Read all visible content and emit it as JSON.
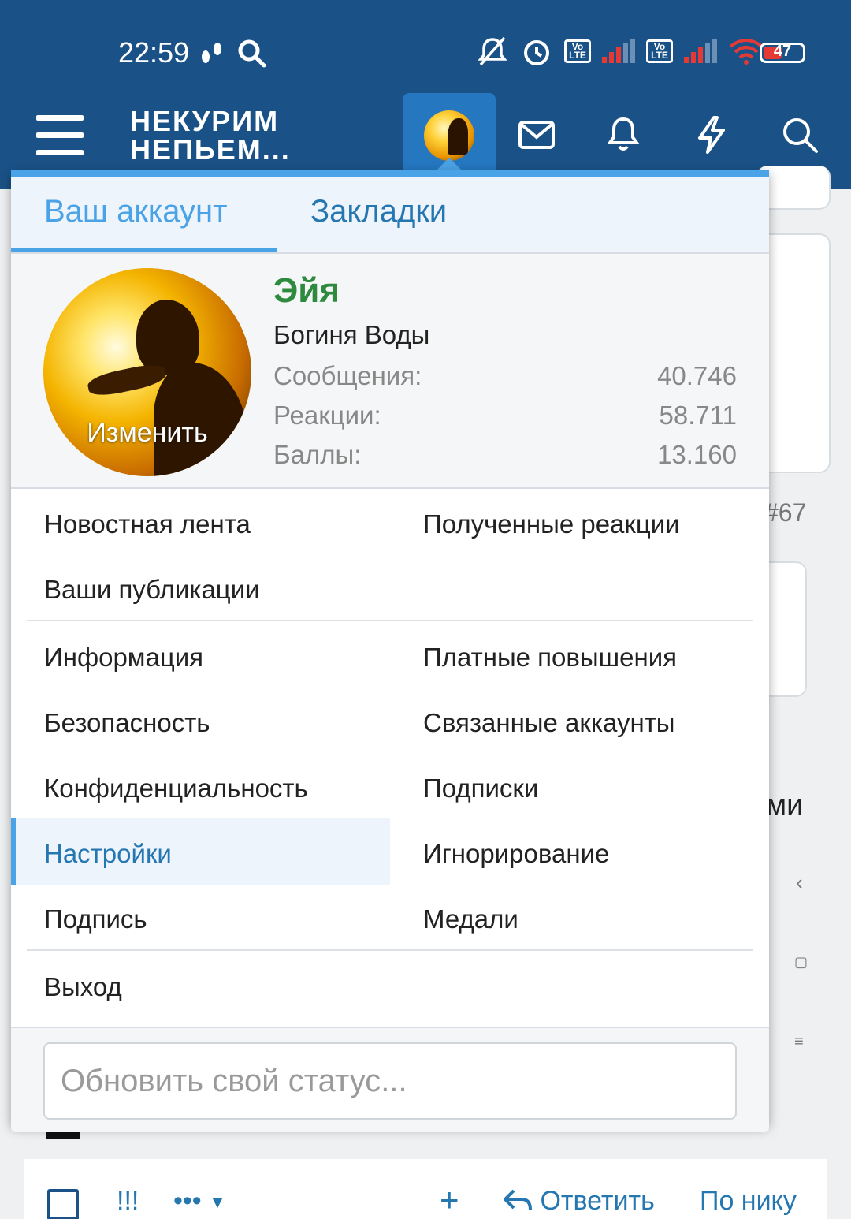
{
  "status_bar": {
    "time": "22:59",
    "battery": "47",
    "battery_level": 0.47,
    "volte": "Vo LTE"
  },
  "header": {
    "logo_line1": "НЕКУРИМ",
    "logo_line2": "НЕПЬЕМ...",
    "icons": [
      "menu-icon",
      "avatar",
      "mail-icon",
      "bell-icon",
      "bolt-icon",
      "search-icon"
    ]
  },
  "background": {
    "post_number": "#67",
    "partial_text": "ми"
  },
  "menu": {
    "tabs": [
      {
        "label": "Ваш аккаунт",
        "active": true
      },
      {
        "label": "Закладки",
        "active": false
      }
    ],
    "profile": {
      "avatar_edit": "Изменить",
      "name": "Эйя",
      "title": "Богиня Воды",
      "stats": [
        {
          "label": "Сообщения:",
          "value": "40.746"
        },
        {
          "label": "Реакции:",
          "value": "58.711"
        },
        {
          "label": "Баллы:",
          "value": "13.160"
        }
      ]
    },
    "items": {
      "news_feed": "Новостная лента",
      "received_reactions": "Полученные реакции",
      "your_posts": "Ваши публикации",
      "info": "Информация",
      "paid_upgrades": "Платные повышения",
      "security": "Безопасность",
      "connected_accounts": "Связанные аккаунты",
      "privacy": "Конфиденциальность",
      "subscriptions": "Подписки",
      "settings": "Настройки",
      "ignoring": "Игнорирование",
      "signature": "Подпись",
      "medals": "Медали",
      "logout": "Выход"
    },
    "status_placeholder": "Обновить свой статус..."
  },
  "bottom_bar": {
    "exclaim": "!!!",
    "more": "•••",
    "plus": "+",
    "reply": "Ответить",
    "by_nick": "По нику"
  },
  "colors": {
    "header_bg": "#1a5287",
    "accent": "#4aa3e6",
    "link": "#2577b1",
    "username": "#2e8a3e",
    "selected_bg": "#eef4fb"
  }
}
